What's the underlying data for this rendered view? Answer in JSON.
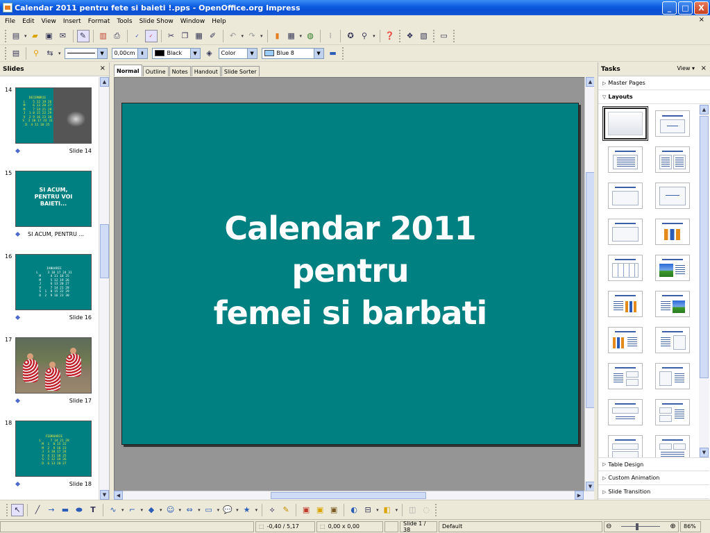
{
  "window": {
    "title": "Calendar 2011 pentru fete si baieti !.pps - OpenOffice.org Impress",
    "minimize": "_",
    "maximize": "□",
    "close": "X",
    "doc_close": "×"
  },
  "menu": [
    "File",
    "Edit",
    "View",
    "Insert",
    "Format",
    "Tools",
    "Slide Show",
    "Window",
    "Help"
  ],
  "toolbar_line": {
    "line_width": "0,00cm",
    "line_color": "Black",
    "area_style": "Color",
    "area_color": "Blue 8",
    "line_color_hex": "#000000",
    "area_color_hex": "#99ccff"
  },
  "slides_pane": {
    "title": "Slides",
    "close": "×",
    "items": [
      {
        "num": "14",
        "label": "Slide 14",
        "kind": "calendar-photo",
        "cal_title": "DECEMBRIE",
        "cal_rows": [
          "L    5 12 19 26",
          "M    6 13 20 27",
          "M    7 14 21 28",
          "J  1 8 15 22 29",
          "V  2 9 16 23 30",
          "S  3 10 17 24 31",
          "D  4 11 18 25"
        ]
      },
      {
        "num": "15",
        "label": "SI ACUM, PENTRU ...",
        "kind": "text",
        "text_lines": [
          "SI  ACUM,",
          "PENTRU VOI",
          "BAIETI..."
        ]
      },
      {
        "num": "16",
        "label": "Slide 16",
        "kind": "calendar",
        "cal_title": "IANUARIE",
        "cal_rows": [
          "L     3 10 17 24 31",
          "M     4 11 18 25",
          "M     5 12 19 26",
          "J     6 13 20 27",
          "V     7 14 21 28",
          "S  1  8 15 22 29",
          "D  2  9 16 23 30"
        ]
      },
      {
        "num": "17",
        "label": "Slide 17",
        "kind": "photo"
      },
      {
        "num": "18",
        "label": "Slide 18",
        "kind": "calendar",
        "cal_title": "FEBRUARIE",
        "cal_rows": [
          "L     7 14 21 28",
          "M  1  8 15 22",
          "M  2  9 16 23",
          "J  3 10 17 24",
          "V  4 11 18 25",
          "S  5 12 19 26",
          "D  6 13 20 27"
        ]
      }
    ]
  },
  "view_tabs": [
    "Normal",
    "Outline",
    "Notes",
    "Handout",
    "Slide Sorter"
  ],
  "current_slide": {
    "title_lines": [
      "Calendar 2011",
      "pentru",
      "femei si barbati"
    ],
    "background": "#008080"
  },
  "tasks_pane": {
    "title": "Tasks",
    "view": "View",
    "close": "×",
    "sections_top": [
      "Master Pages",
      "Layouts"
    ],
    "sections_bottom": [
      "Table Design",
      "Custom Animation",
      "Slide Transition"
    ]
  },
  "status": {
    "position": "-0,40 / 5,17",
    "size": "0,00 x 0,00",
    "slide": "Slide 1 / 38",
    "master": "Default",
    "zoom": "86%",
    "zoom_fraction": 0.43
  }
}
